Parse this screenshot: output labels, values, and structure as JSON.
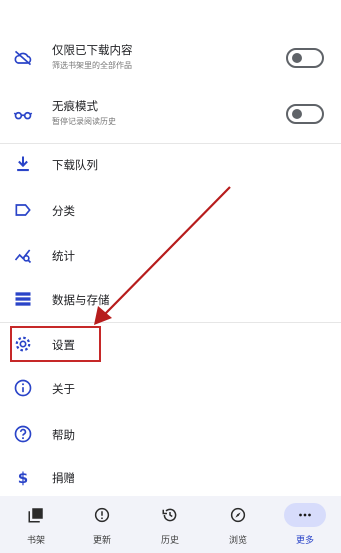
{
  "settings": {
    "downloaded_only": {
      "title": "仅限已下载内容",
      "subtitle": "筛选书架里的全部作品",
      "icon": "cloud-off-icon",
      "enabled": false
    },
    "incognito": {
      "title": "无痕模式",
      "subtitle": "暂停记录阅读历史",
      "icon": "glasses-icon",
      "enabled": false
    }
  },
  "menu": {
    "download_queue": "下载队列",
    "categories": "分类",
    "stats": "统计",
    "data_storage": "数据与存储",
    "settings": "设置",
    "about": "关于",
    "help": "帮助",
    "donate": "捐赠"
  },
  "bottom_nav": {
    "library": "书架",
    "updates": "更新",
    "history": "历史",
    "browse": "浏览",
    "more": "更多"
  },
  "colors": {
    "accent": "#2a44c8",
    "highlight_border": "#c62828",
    "active_pill": "#d7dcfb",
    "nav_background": "#f2f3f9"
  }
}
